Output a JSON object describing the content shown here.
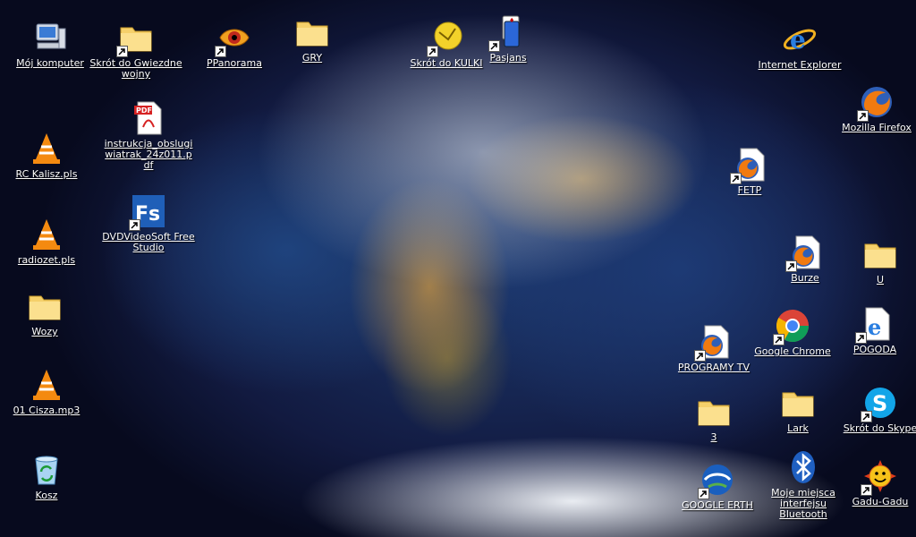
{
  "desktop": {
    "icons": [
      {
        "id": "my-computer",
        "label": "Mój komputer",
        "icon": "computer-icon"
      },
      {
        "id": "star-wars",
        "label": "Skrót do Gwiezdne wojny",
        "icon": "folder-icon"
      },
      {
        "id": "ppanorama",
        "label": "PPanorama",
        "icon": "panorama-icon"
      },
      {
        "id": "gry",
        "label": "GRY",
        "icon": "folder-icon"
      },
      {
        "id": "kulki",
        "label": "Skrót do KULKI",
        "icon": "game-ball-icon"
      },
      {
        "id": "pasjans",
        "label": "Pasjans",
        "icon": "cards-icon"
      },
      {
        "id": "internet-explorer",
        "label": "Internet Explorer",
        "icon": "internet-explorer-icon"
      },
      {
        "id": "firefox",
        "label": "Mozilla Firefox",
        "icon": "firefox-icon"
      },
      {
        "id": "pdf",
        "label": "instrukcja_obslugi wiatrak_24z011.pdf",
        "icon": "pdf-icon"
      },
      {
        "id": "rc-kalisz",
        "label": "RC Kalisz.pls",
        "icon": "vlc-icon"
      },
      {
        "id": "dvdvideosoft",
        "label": "DVDVideoSoft Free Studio",
        "icon": "fs-app-icon"
      },
      {
        "id": "fetp",
        "label": "FETP",
        "icon": "firefox-document-icon"
      },
      {
        "id": "radiozet",
        "label": "radiozet.pls",
        "icon": "vlc-icon"
      },
      {
        "id": "burze",
        "label": "Burze",
        "icon": "firefox-document-icon"
      },
      {
        "id": "u",
        "label": "U",
        "icon": "folder-icon"
      },
      {
        "id": "wozy",
        "label": "Wozy",
        "icon": "folder-icon"
      },
      {
        "id": "programy-tv",
        "label": "PROGRAMY TV",
        "icon": "firefox-document-icon"
      },
      {
        "id": "chrome",
        "label": "Google Chrome",
        "icon": "chrome-icon"
      },
      {
        "id": "pogoda",
        "label": "POGODA",
        "icon": "ie-document-icon"
      },
      {
        "id": "cisza",
        "label": "01 Cisza.mp3",
        "icon": "vlc-icon"
      },
      {
        "id": "folder-3",
        "label": "3",
        "icon": "folder-icon"
      },
      {
        "id": "lark",
        "label": "Lark",
        "icon": "folder-icon"
      },
      {
        "id": "skype",
        "label": "Skrót do Skype",
        "icon": "skype-icon"
      },
      {
        "id": "kosz",
        "label": "Kosz",
        "icon": "recycle-bin-icon"
      },
      {
        "id": "google-earth",
        "label": "GOOGLE ERTH",
        "icon": "google-earth-icon"
      },
      {
        "id": "bluetooth",
        "label": "Moje miejsca interfejsu Bluetooth",
        "icon": "bluetooth-icon"
      },
      {
        "id": "gadu-gadu",
        "label": "Gadu-Gadu",
        "icon": "gadu-gadu-icon"
      }
    ]
  }
}
